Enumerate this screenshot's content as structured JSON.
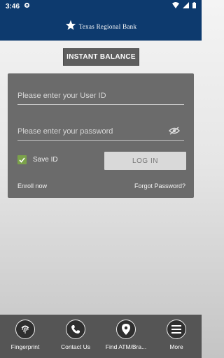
{
  "status_bar": {
    "time": "3:46"
  },
  "header": {
    "brand_name": "Texas Regional Bank"
  },
  "instant_balance_label": "INSTANT BALANCE",
  "login": {
    "user_id_placeholder": "Please enter your User ID",
    "password_placeholder": "Please enter your password",
    "save_id_label": "Save ID",
    "save_id_checked": true,
    "login_label": "LOG IN",
    "enroll_label": "Enroll now",
    "forgot_label": "Forgot Password?"
  },
  "bottom_nav": [
    {
      "label": "Fingerprint",
      "icon": "fingerprint-icon"
    },
    {
      "label": "Contact Us",
      "icon": "phone-icon"
    },
    {
      "label": "Find ATM/Bra...",
      "icon": "location-pin-icon"
    },
    {
      "label": "More",
      "icon": "menu-icon"
    }
  ],
  "colors": {
    "header_bg": "#0d3a6e",
    "card_bg": "#6b6b6b",
    "checkbox": "#7ba24a",
    "nav_bg": "#555555"
  }
}
